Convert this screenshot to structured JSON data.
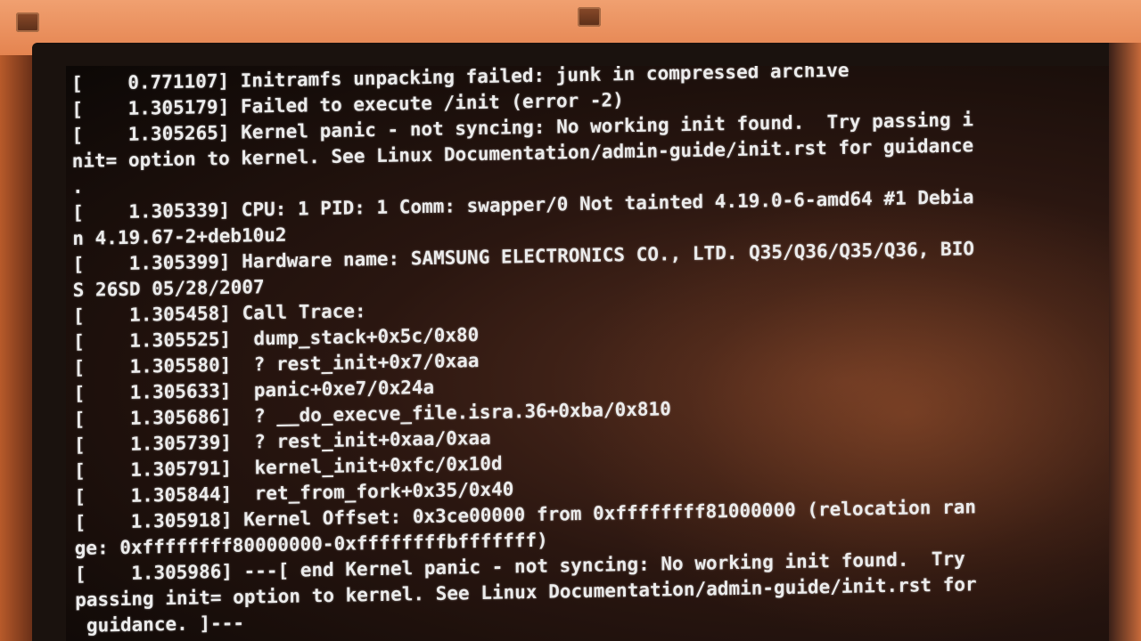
{
  "console": {
    "lines": [
      "[    0.771107] Initramfs unpacking failed: junk in compressed archive",
      "[    1.305179] Failed to execute /init (error -2)",
      "[    1.305265] Kernel panic - not syncing: No working init found.  Try passing i",
      "nit= option to kernel. See Linux Documentation/admin-guide/init.rst for guidance",
      ".",
      "[    1.305339] CPU: 1 PID: 1 Comm: swapper/0 Not tainted 4.19.0-6-amd64 #1 Debia",
      "n 4.19.67-2+deb10u2",
      "[    1.305399] Hardware name: SAMSUNG ELECTRONICS CO., LTD. Q35/Q36/Q35/Q36, BIO",
      "S 26SD 05/28/2007",
      "[    1.305458] Call Trace:",
      "[    1.305525]  dump_stack+0x5c/0x80",
      "[    1.305580]  ? rest_init+0x7/0xaa",
      "[    1.305633]  panic+0xe7/0x24a",
      "[    1.305686]  ? __do_execve_file.isra.36+0xba/0x810",
      "[    1.305739]  ? rest_init+0xaa/0xaa",
      "[    1.305791]  kernel_init+0xfc/0x10d",
      "[    1.305844]  ret_from_fork+0x35/0x40",
      "[    1.305918] Kernel Offset: 0x3ce00000 from 0xffffffff81000000 (relocation ran",
      "ge: 0xffffffff80000000-0xffffffffbfffffff)",
      "[    1.305986] ---[ end Kernel panic - not syncing: No working init found.  Try",
      "passing init= option to kernel. See Linux Documentation/admin-guide/init.rst for",
      " guidance. ]---"
    ]
  }
}
